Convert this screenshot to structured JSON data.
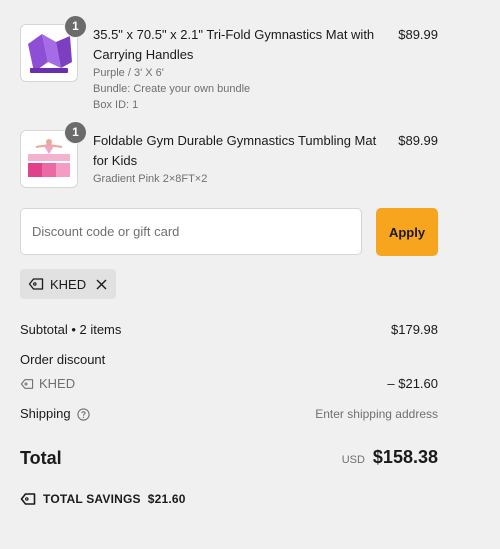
{
  "colors": {
    "background": "#f0f0f0",
    "apply_button": "#f7a51e",
    "quantity_badge": "#6b6b6b"
  },
  "items": [
    {
      "quantity": "1",
      "title": "35.5\" x 70.5\" x 2.1\" Tri-Fold Gymnastics Mat with Carrying Handles",
      "variant": "Purple / 3' X 6'",
      "bundle": "Bundle: Create your own bundle",
      "box_id": "Box ID: 1",
      "price": "$89.99",
      "image_icon": "purple-folding-mat-image"
    },
    {
      "quantity": "1",
      "title": "Foldable Gym Durable Gymnastics Tumbling Mat for Kids",
      "variant": "Gradient Pink 2×8FT×2",
      "price": "$89.99",
      "image_icon": "pink-tumbling-mat-image"
    }
  ],
  "discount": {
    "placeholder": "Discount code or gift card",
    "value": "",
    "apply_label": "Apply",
    "applied_code": "KHED"
  },
  "summary": {
    "subtotal_label": "Subtotal • 2 items",
    "subtotal_value": "$179.98",
    "order_discount_label": "Order discount",
    "discount_code": "KHED",
    "discount_value": "– $21.60",
    "shipping_label": "Shipping",
    "shipping_value": "Enter shipping address",
    "total_label": "Total",
    "currency": "USD",
    "total_value": "$158.38",
    "savings_label": "TOTAL SAVINGS",
    "savings_value": "$21.60"
  }
}
